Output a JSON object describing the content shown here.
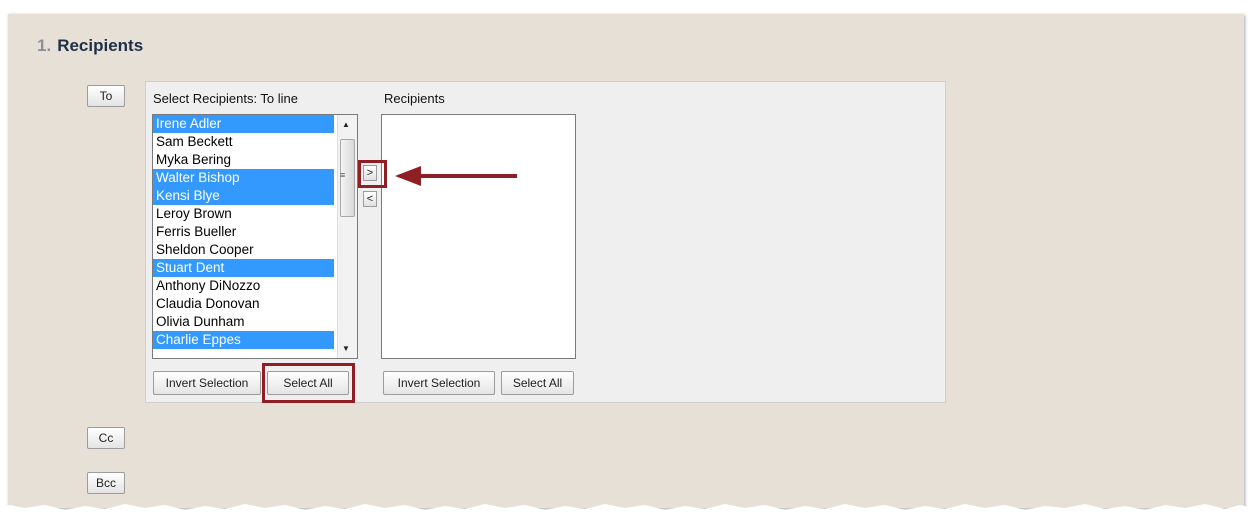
{
  "section": {
    "number": "1.",
    "title": "Recipients"
  },
  "address_buttons": {
    "to": "To",
    "cc": "Cc",
    "bcc": "Bcc"
  },
  "select_label": "Select Recipients: To line",
  "recipients_label": "Recipients",
  "available": [
    {
      "name": "Irene Adler",
      "selected": true
    },
    {
      "name": "Sam Beckett",
      "selected": false
    },
    {
      "name": "Myka Bering",
      "selected": false
    },
    {
      "name": "Walter Bishop",
      "selected": true
    },
    {
      "name": "Kensi Blye",
      "selected": true
    },
    {
      "name": "Leroy Brown",
      "selected": false
    },
    {
      "name": "Ferris Bueller",
      "selected": false
    },
    {
      "name": "Sheldon Cooper",
      "selected": false
    },
    {
      "name": "Stuart Dent",
      "selected": true
    },
    {
      "name": "Anthony DiNozzo",
      "selected": false
    },
    {
      "name": "Claudia Donovan",
      "selected": false
    },
    {
      "name": "Olivia Dunham",
      "selected": false
    },
    {
      "name": "Charlie Eppes",
      "selected": true
    }
  ],
  "move_buttons": {
    "add": ">",
    "remove": "<"
  },
  "left_actions": {
    "invert": "Invert Selection",
    "select_all": "Select All"
  },
  "right_actions": {
    "invert": "Invert Selection",
    "select_all": "Select All"
  },
  "icons": {
    "scroll_up": "▲",
    "scroll_down": "▼",
    "grip": "≡"
  },
  "colors": {
    "selection": "#3399ff",
    "highlight": "#8f1f24",
    "panel": "#e6e0d6",
    "heading": "#1f2f47"
  }
}
